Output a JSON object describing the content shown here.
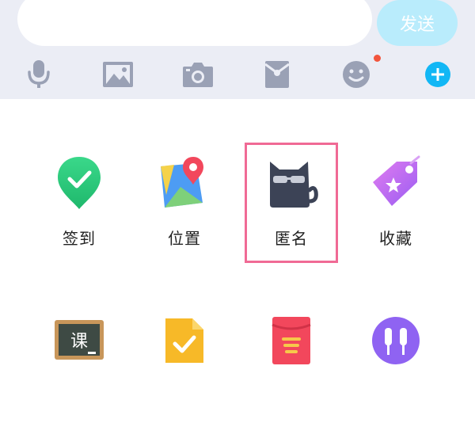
{
  "input_bar": {
    "input_value": "",
    "send_label": "发送"
  },
  "toolbar": {
    "icons": [
      "microphone-icon",
      "image-icon",
      "camera-icon",
      "red-packet-icon",
      "emoji-icon",
      "plus-icon"
    ],
    "emoji_has_badge": true
  },
  "colors": {
    "top_bar_bg": "#ebedf5",
    "send_button_bg": "#b9ecfc",
    "toolbar_icon": "#9aa1b5",
    "plus_accent": "#12b7f5",
    "badge_red": "#f2553d",
    "highlight_border": "#f06a95"
  },
  "grid": {
    "items": [
      {
        "label": "签到",
        "icon": "checkin-pin-icon"
      },
      {
        "label": "位置",
        "icon": "location-map-icon"
      },
      {
        "label": "匿名",
        "icon": "anonymous-cat-icon",
        "highlighted": true
      },
      {
        "label": "收藏",
        "icon": "favorite-tag-icon"
      },
      {
        "label": "",
        "icon": "class-blackboard-icon"
      },
      {
        "label": "",
        "icon": "homework-doc-icon"
      },
      {
        "label": "",
        "icon": "red-envelope-icon"
      },
      {
        "label": "",
        "icon": "earphones-icon"
      }
    ]
  }
}
